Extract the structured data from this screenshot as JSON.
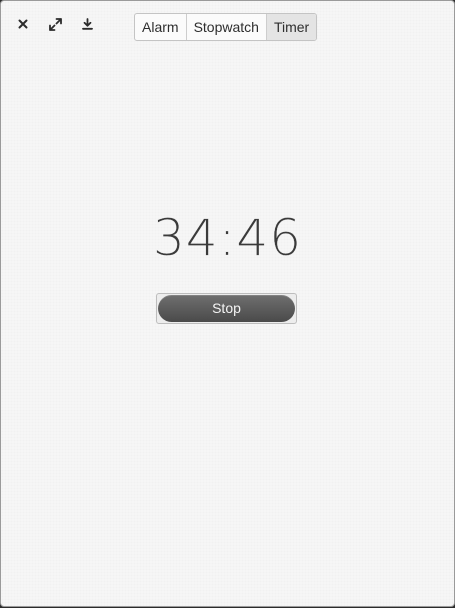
{
  "window": {
    "controls": [
      {
        "name": "close-icon"
      },
      {
        "name": "maximize-icon"
      },
      {
        "name": "minimize-icon"
      }
    ]
  },
  "modes": {
    "items": [
      "Alarm",
      "Stopwatch",
      "Timer"
    ],
    "active": "Timer"
  },
  "timer": {
    "display": "34:46",
    "stop_label": "Stop"
  },
  "colors": {
    "background": "#f6f6f6",
    "button": "#5a5a5a",
    "text": "#3a3a3a"
  }
}
